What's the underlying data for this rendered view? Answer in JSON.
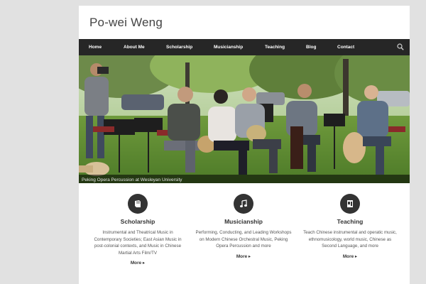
{
  "site": {
    "title": "Po-wei Weng"
  },
  "nav": {
    "items": [
      {
        "label": "Home"
      },
      {
        "label": "About Me"
      },
      {
        "label": "Scholarship"
      },
      {
        "label": "Musicianship"
      },
      {
        "label": "Teaching"
      },
      {
        "label": "Blog"
      },
      {
        "label": "Contact"
      }
    ],
    "search_icon": "search-icon"
  },
  "hero": {
    "caption": "Peking Opera Percussion at Wesleyan University"
  },
  "features": [
    {
      "icon": "book-icon",
      "title": "Scholarship",
      "description": "Instrumental and Theatrical Music in Contemporary Societies; East Asian Music in post-colonial contexts, and Music in Chinese Martial Arts Film/TV",
      "more": "More"
    },
    {
      "icon": "music-note-icon",
      "title": "Musicianship",
      "description": "Performing, Conducting, and Leading Workshops on Modern Chinese Orchestral Music, Peking Opera Percussion and more",
      "more": "More"
    },
    {
      "icon": "teaching-icon",
      "title": "Teaching",
      "description": "Teach Chinese instrumental and operatic music, ethnomusicology, world music, Chinese as Second Language, and more",
      "more": "More"
    }
  ],
  "colors": {
    "background": "#e1e1e1",
    "nav": "#262626",
    "icon_circle": "#333333",
    "text": "#333333"
  }
}
